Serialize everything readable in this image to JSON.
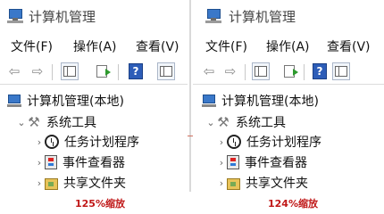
{
  "panels": [
    {
      "title": "计算机管理",
      "menu": [
        "文件(F)",
        "操作(A)",
        "查看(V)"
      ],
      "tree": {
        "root": "计算机管理(本地)",
        "group": "系统工具",
        "items": [
          "任务计划程序",
          "事件查看器",
          "共享文件夹"
        ]
      },
      "caption": "125%缩放"
    },
    {
      "title": "计算机管理",
      "menu": [
        "文件(F)",
        "操作(A)",
        "查看(V)"
      ],
      "tree": {
        "root": "计算机管理(本地)",
        "group": "系统工具",
        "items": [
          "任务计划程序",
          "事件查看器",
          "共享文件夹"
        ]
      },
      "caption": "124%缩放"
    }
  ],
  "toolbar_icons": [
    "back-arrow-icon",
    "forward-arrow-icon",
    "console-tree-icon",
    "export-list-icon",
    "help-icon",
    "action-pane-icon"
  ],
  "colors": {
    "caption": "#c01818",
    "guide_line": "#d07060",
    "accent_blue": "#2d5db8"
  }
}
